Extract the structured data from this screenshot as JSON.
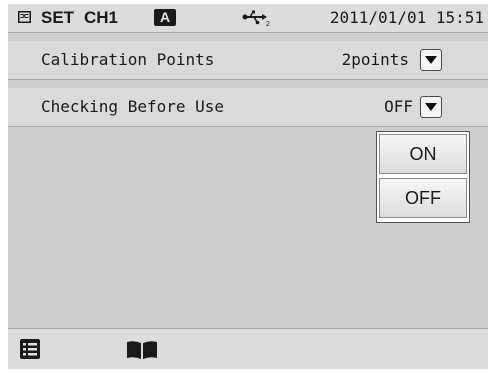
{
  "status_bar": {
    "set_label": "SET",
    "channel": "CH1",
    "mode_badge": "A",
    "datetime": "2011/01/01 15:51"
  },
  "settings": [
    {
      "label": "Calibration Points",
      "value": "2points"
    },
    {
      "label": "Checking Before Use",
      "value": "OFF"
    }
  ],
  "dropdown_popup": {
    "options": [
      "ON",
      "OFF"
    ]
  },
  "bottom_bar": {
    "icons": [
      "list-icon",
      "book-icon"
    ]
  },
  "colors": {
    "screen_bg": "#cfcfcf",
    "row_bg": "#dadada",
    "text": "#1a1a1a"
  }
}
